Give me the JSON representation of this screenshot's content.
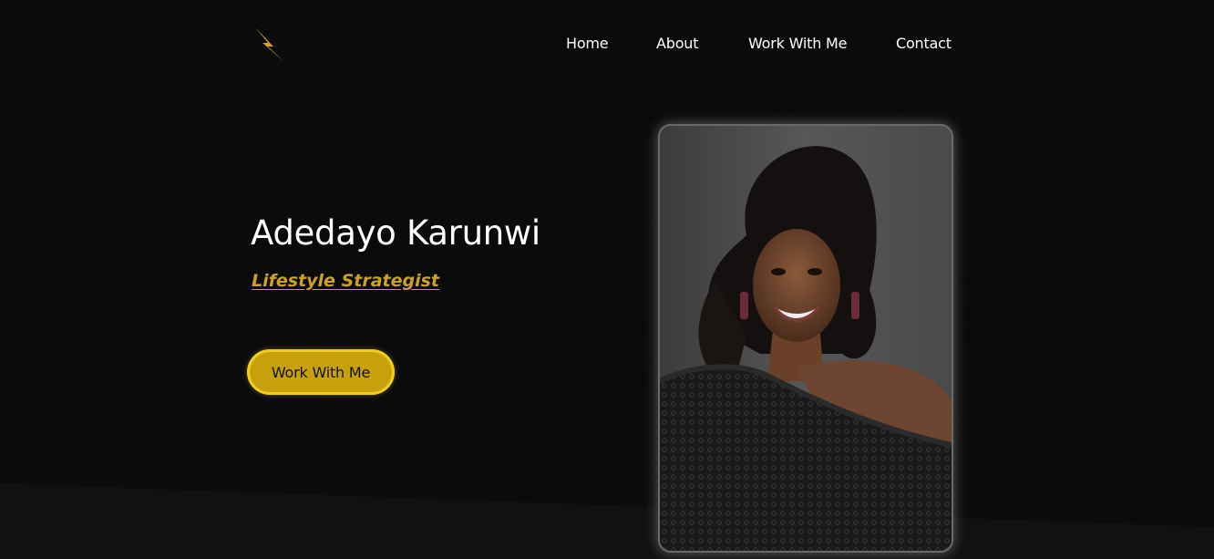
{
  "nav": {
    "logo_icon": "lightning-bolt-icon",
    "items": [
      {
        "label": "Home"
      },
      {
        "label": "About"
      },
      {
        "label": "Work With Me"
      },
      {
        "label": "Contact"
      }
    ]
  },
  "hero": {
    "name": "Adedayo Karunwi",
    "role": "Lifestyle Strategist",
    "cta_label": "Work With Me"
  },
  "colors": {
    "background": "#0a0a0b",
    "accent": "#c9a227",
    "button_fill": "#c8a20d",
    "button_border": "#f2cf1f",
    "text": "#ffffff"
  }
}
